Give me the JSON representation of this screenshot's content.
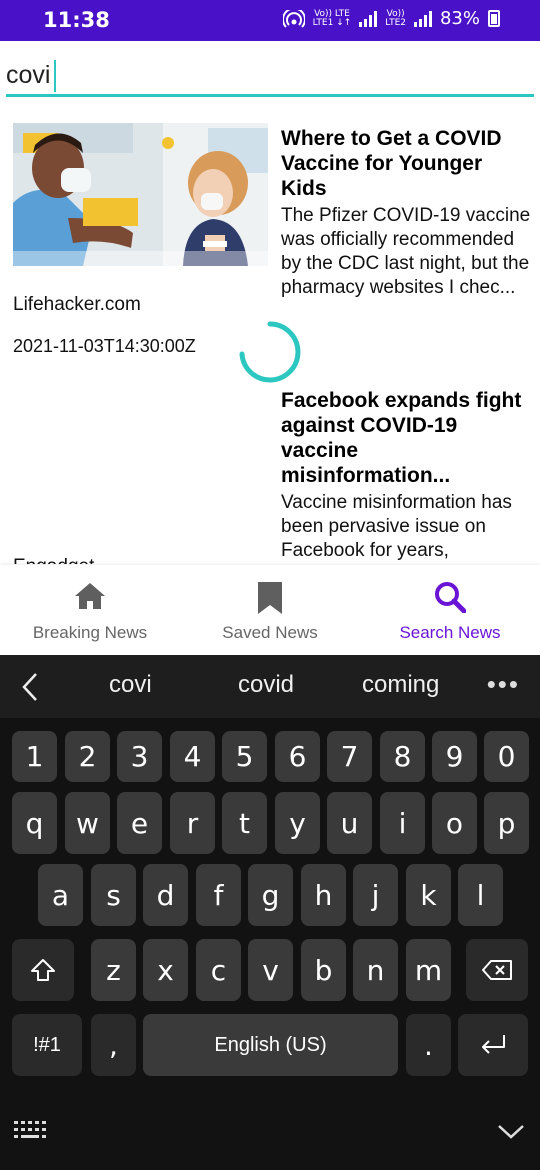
{
  "status": {
    "time": "11:38",
    "lte1_top": "Vo)) LTE",
    "lte1_bottom": "LTE1 ↓↑",
    "lte2_top": "Vo))",
    "lte2_bottom": "LTE2",
    "battery": "83%"
  },
  "search": {
    "value": "covi",
    "placeholder": ""
  },
  "articles": [
    {
      "source": "Lifehacker.com",
      "date": "2021-11-03T14:30:00Z",
      "title": "Where to Get a COVID Vaccine for Younger Kids",
      "description": "The Pfizer COVID-19 vaccine was officially recommended by the CDC last night, but the pharmacy websites I chec..."
    },
    {
      "source": "Engadget",
      "title": "Facebook expands fight against COVID-19 vaccine misinformation...",
      "description": "Vaccine misinformation has been pervasive issue on Facebook for years,"
    }
  ],
  "nav": [
    {
      "label": "Breaking News",
      "icon": "home-icon",
      "active": false
    },
    {
      "label": "Saved News",
      "icon": "bookmark-icon",
      "active": false
    },
    {
      "label": "Search News",
      "icon": "search-icon",
      "active": true
    }
  ],
  "colors": {
    "accent": "#2cc7c0",
    "status_bar": "#4a12c8",
    "nav_active": "#6a14d6"
  },
  "keyboard": {
    "suggestions": [
      "covi",
      "covid",
      "coming"
    ],
    "more": "•••",
    "row_numbers": [
      "1",
      "2",
      "3",
      "4",
      "5",
      "6",
      "7",
      "8",
      "9",
      "0"
    ],
    "row1": [
      "q",
      "w",
      "e",
      "r",
      "t",
      "y",
      "u",
      "i",
      "o",
      "p"
    ],
    "row2": [
      "a",
      "s",
      "d",
      "f",
      "g",
      "h",
      "j",
      "k",
      "l"
    ],
    "row3": [
      "z",
      "x",
      "c",
      "v",
      "b",
      "n",
      "m"
    ],
    "symbols": "!#1",
    "comma": ",",
    "space": "English (US)",
    "period": "."
  }
}
